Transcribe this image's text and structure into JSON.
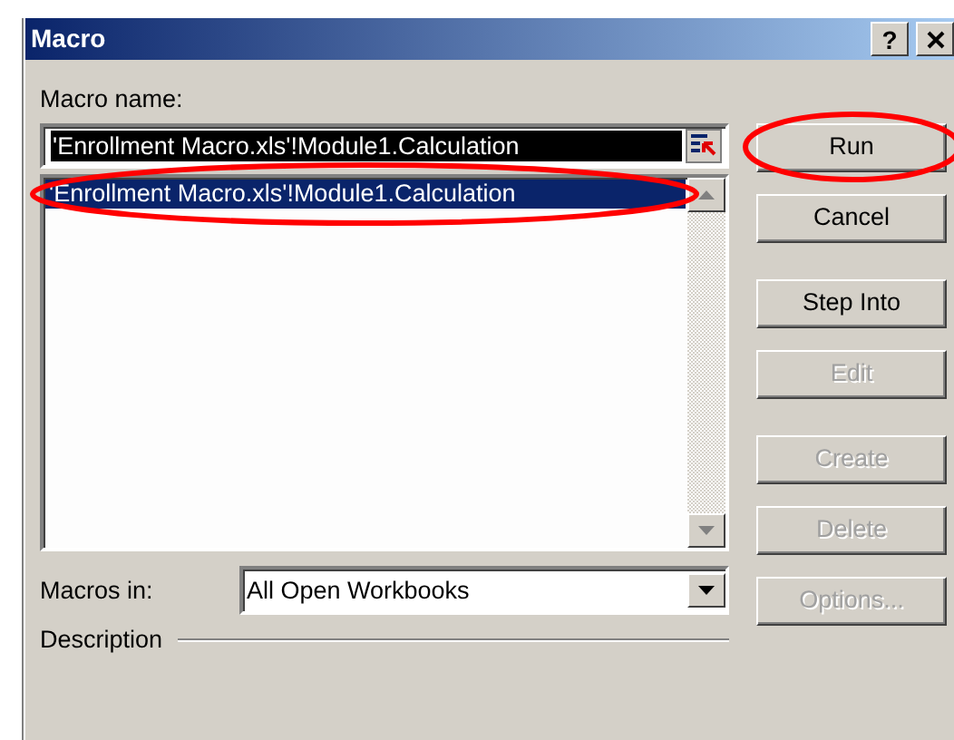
{
  "window": {
    "title": "Macro",
    "help_label": "?"
  },
  "macro_name": {
    "label": "Macro name:",
    "value": "'Enrollment Macro.xls'!Module1.Calculation"
  },
  "macro_list": {
    "items": [
      {
        "label": "'Enrollment Macro.xls'!Module1.Calculation",
        "selected": true,
        "circled": true
      }
    ]
  },
  "macros_in": {
    "label": "Macros in:",
    "value": "All Open Workbooks"
  },
  "description": {
    "label": "Description"
  },
  "button_groups": [
    {
      "buttons": [
        {
          "label": "Run",
          "disabled": false,
          "circled": true
        },
        {
          "label": "Cancel",
          "disabled": false,
          "circled": false
        }
      ]
    },
    {
      "buttons": [
        {
          "label": "Step Into",
          "disabled": false,
          "circled": false
        },
        {
          "label": "Edit",
          "disabled": true,
          "circled": false
        }
      ]
    },
    {
      "buttons": [
        {
          "label": "Create",
          "disabled": true,
          "circled": false
        },
        {
          "label": "Delete",
          "disabled": true,
          "circled": false
        },
        {
          "label": "Options...",
          "disabled": true,
          "circled": false
        }
      ]
    }
  ]
}
